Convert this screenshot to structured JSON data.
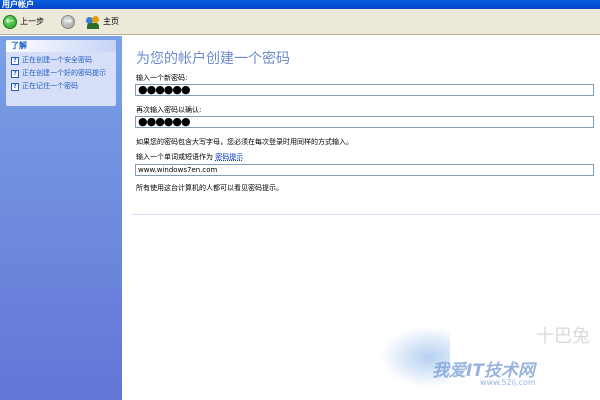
{
  "window": {
    "title": "用户帐户"
  },
  "toolbar": {
    "back_label": "上一步",
    "home_label": "主页"
  },
  "sidebar": {
    "panel_title": "了解",
    "items": [
      {
        "label": "正在创建一个安全密码"
      },
      {
        "label": "正在创建一个好的密码提示"
      },
      {
        "label": "正在记住一个密码"
      }
    ]
  },
  "main": {
    "heading": "为您的帐户创建一个密码",
    "new_password_label": "输入一个新密码:",
    "new_password_value": "●●●●●●",
    "confirm_password_label": "再次输入密码以确认:",
    "confirm_password_value": "●●●●●●",
    "case_note": "如果您的密码包含大写字母，您必须在每次登录时用同样的方式输入。",
    "hint_prompt": "输入一个单词或短语作为",
    "hint_link": "密码提示",
    "hint_value": "www.windows7en.com",
    "visible_note": "所有使用这台计算机的人都可以看见密码提示。"
  },
  "watermark": {
    "logo": "十巴兔",
    "site": "我爱IT技术网",
    "url": "www.52ij.com"
  },
  "colors": {
    "titlebar": "#0a5fe0",
    "sidebar": "#6e8ee0",
    "heading": "#6b8bd0",
    "link": "#215dc6"
  }
}
